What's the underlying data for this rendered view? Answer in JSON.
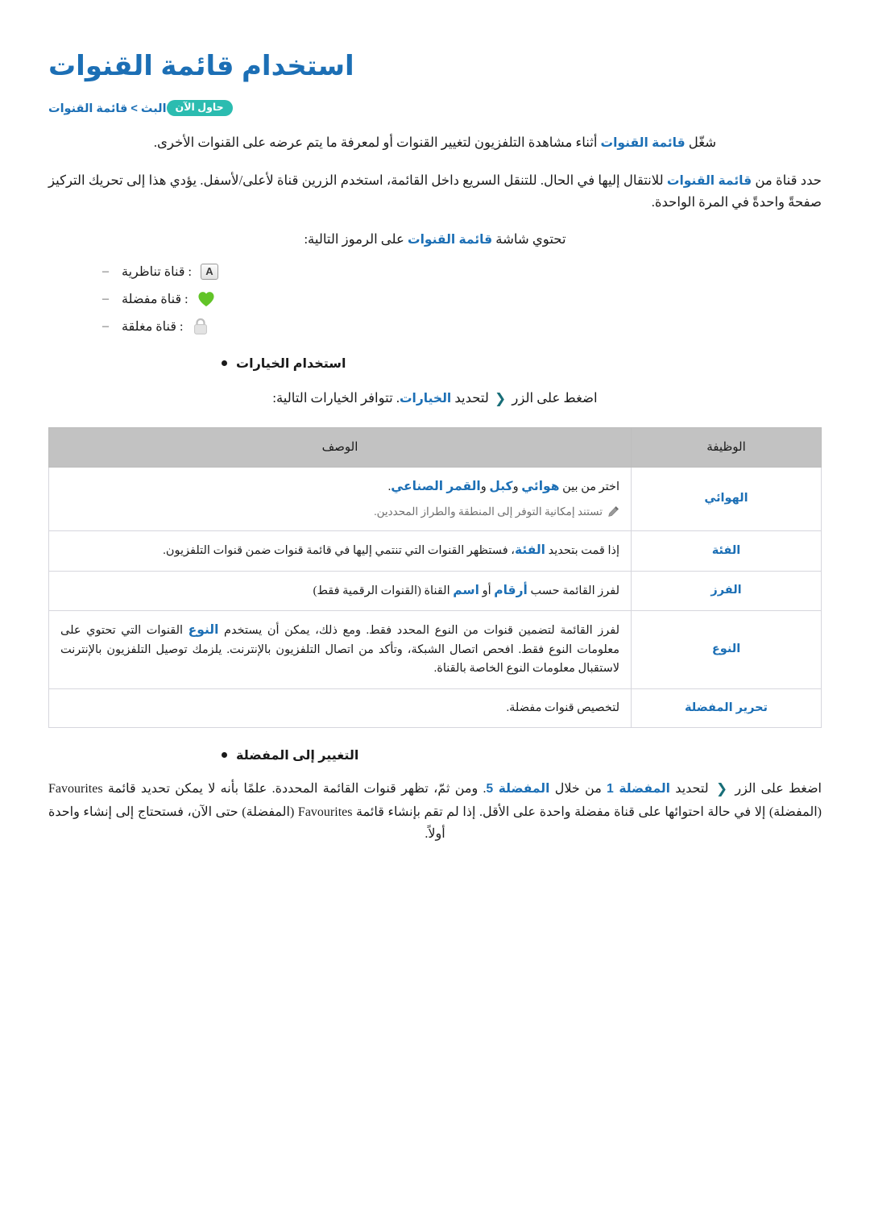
{
  "page": {
    "title": "استخدام قائمة القنوات",
    "breadcrumb": "البث > قائمة القنوات",
    "try_now_badge": "حاول الآن",
    "accent_blue": "#1c6fb5",
    "accent_teal": "#2bbcb0",
    "chevron_glyph": "❮"
  },
  "intro": {
    "para1_a": "شغّل ",
    "para1_link": "قائمة القنوات",
    "para1_b": " أثناء مشاهدة التلفزيون لتغيير القنوات أو لمعرفة ما يتم عرضه على القنوات الأخرى.",
    "para2_a": "حدد قناة من ",
    "para2_link": "قائمة القنوات",
    "para2_b": " للانتقال إليها في الحال. للتنقل السريع داخل القائمة، استخدم الزرين قناة لأعلى/لأسفل. يؤدي هذا إلى تحريك التركيز صفحةً واحدةً في المرة الواحدة.",
    "para3_a": "تحتوي شاشة ",
    "para3_link": "قائمة القنوات",
    "para3_b": " على الرموز التالية:"
  },
  "legend": {
    "dash": "–",
    "items": [
      {
        "icon": "analog-channel-icon",
        "glyph": "A",
        "label": ": قناة تناظرية"
      },
      {
        "icon": "favourite-heart-icon",
        "glyph": "",
        "label": ": قناة مفضلة"
      },
      {
        "icon": "locked-padlock-icon",
        "glyph": "",
        "label": ": قناة مغلقة"
      }
    ]
  },
  "options_section": {
    "bullet_title": "استخدام الخيارات",
    "instruction_a": "اضغط على الزر ",
    "instruction_b": " لتحديد ",
    "instruction_link": "الخيارات",
    "instruction_c": ". تتوافر الخيارات التالية:"
  },
  "table": {
    "headers": {
      "function": "الوظيفة",
      "description": "الوصف"
    },
    "rows": [
      {
        "function": "الهوائي",
        "desc_prefix": "اختر من بين ",
        "desc_link1": "هوائي",
        "desc_mid1": " و",
        "desc_link2": "كبل",
        "desc_mid2": " و",
        "desc_link3": "القمر الصناعي",
        "desc_suffix": ".",
        "note": "تستند إمكانية التوفر إلى المنطقة والطراز المحددين.",
        "has_note": true
      },
      {
        "function": "الفئة",
        "desc_prefix": "إذا قمت بتحديد ",
        "desc_link1": "الفئة",
        "desc_suffix": "، فستظهر القنوات التي تنتمي إليها في قائمة قنوات ضمن قنوات التلفزيون.",
        "has_note": false
      },
      {
        "function": "الفرز",
        "desc_prefix": "لفرز القائمة حسب ",
        "desc_link1": "أرقام",
        "desc_mid1": " أو ",
        "desc_link2": "اسم",
        "desc_suffix": " القناة (القنوات الرقمية فقط)",
        "has_note": false
      },
      {
        "function": "النوع",
        "desc_prefix": "لفرز القائمة لتضمين قنوات من النوع المحدد فقط. ومع ذلك، يمكن أن يستخدم ",
        "desc_link1": "النوع",
        "desc_suffix": " القنوات التي تحتوي على معلومات النوع فقط. افحص اتصال الشبكة، وتأكد من اتصال التلفزيون بالإنترنت. يلزمك توصيل التلفزيون بالإنترنت لاستقبال معلومات النوع الخاصة بالقناة.",
        "has_note": false
      },
      {
        "function": "تحرير المفضلة",
        "desc_prefix": "لتخصيص قنوات مفضلة.",
        "has_note": false
      }
    ]
  },
  "favourites_section": {
    "bullet_title": "التغيير إلى المفضلة",
    "p_a": "اضغط على الزر ",
    "p_b": " لتحديد ",
    "p_link1": "المفضلة 1",
    "p_c": " من خلال ",
    "p_link2": "المفضلة 5",
    "p_d": ". ومن ثمّ، تظهر قنوات القائمة المحددة. علمًا بأنه لا يمكن تحديد قائمة Favourites (المفضلة) إلا في حالة احتوائها على قناة مفضلة واحدة على الأقل. إذا لم تقم بإنشاء قائمة Favourites (المفضلة) حتى الآن، فستحتاج إلى إنشاء واحدة أولاً."
  }
}
